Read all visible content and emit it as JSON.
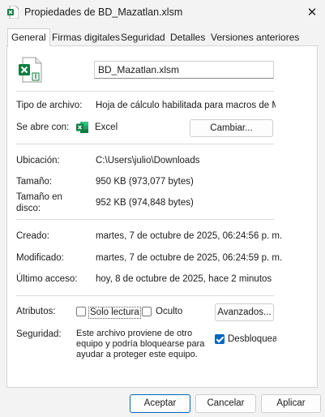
{
  "window": {
    "title": "Propiedades de BD_Mazatlan.xlsm",
    "close_symbol": "✕",
    "app_icon": "excel-file-icon"
  },
  "tabs": [
    {
      "label": "General",
      "active": true
    },
    {
      "label": "Firmas digitales",
      "active": false
    },
    {
      "label": "Seguridad",
      "active": false
    },
    {
      "label": "Detalles",
      "active": false
    },
    {
      "label": "Versiones anteriores",
      "active": false
    }
  ],
  "file": {
    "icon": "excel-file-icon",
    "name": "BD_Mazatlan.xlsm"
  },
  "type_section": {
    "file_type_label": "Tipo de archivo:",
    "file_type_value": "Hoja de cálculo habilitada para macros de Micro",
    "opens_with_label": "Se abre con:",
    "opens_with_icon": "excel-app-icon",
    "opens_with_value": "Excel",
    "change_button": "Cambiar..."
  },
  "location_section": {
    "location_label": "Ubicación:",
    "location_value": "C:\\Users\\julio\\Downloads",
    "size_label": "Tamaño:",
    "size_value": "950 KB (973,077 bytes)",
    "size_on_disk_label_line1": "Tamaño en",
    "size_on_disk_label_line2": "disco:",
    "size_on_disk_value": "952 KB (974,848 bytes)"
  },
  "dates_section": {
    "created_label": "Creado:",
    "created_value": "martes, 7 de octubre de 2025, 06:24:56 p. m.",
    "modified_label": "Modificado:",
    "modified_value": "martes, 7 de octubre de 2025, 06:24:59 p. m.",
    "accessed_label": "Último acceso:",
    "accessed_value": "hoy, 8 de octubre de 2025, hace 2 minutos"
  },
  "attributes_section": {
    "attributes_label": "Atributos:",
    "readonly_label": "Solo lectura",
    "readonly_checked": false,
    "hidden_label": "Oculto",
    "hidden_checked": false,
    "advanced_button": "Avanzados...",
    "security_label": "Seguridad:",
    "security_text": "Este archivo proviene de otro equipo y podría bloquearse para ayudar a proteger este equipo.",
    "unblock_label": "Desbloquear",
    "unblock_checked": true
  },
  "footer": {
    "accept": "Aceptar",
    "cancel": "Cancelar",
    "apply": "Aplicar"
  },
  "colors": {
    "accent": "#0067c0",
    "excel_green": "#107c41",
    "background": "#f3f3f3"
  }
}
